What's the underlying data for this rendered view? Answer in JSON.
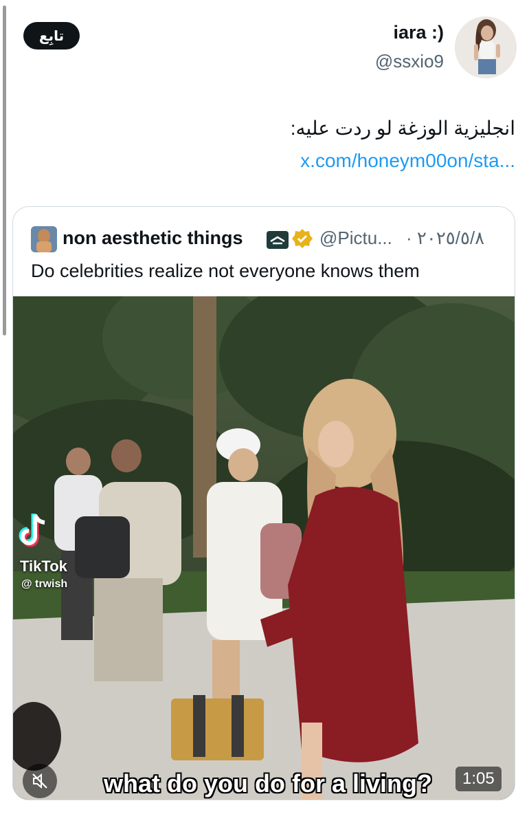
{
  "header": {
    "follow_label": "تابِع",
    "display_name": "iara :)",
    "handle": "@ssxio9"
  },
  "tweet": {
    "text": "انجليزية الوزغة لو ردت عليه:",
    "link": "x.com/honeym00on/sta..."
  },
  "quote": {
    "name": "non aesthetic things",
    "handle": "@Pictu...",
    "date": "٢٠٢٥/٥/٨ ·",
    "text": "Do celebrities realize not everyone knows them",
    "video": {
      "watermark_brand": "TikTok",
      "watermark_user": "@ trwish",
      "subtitle": "what do you do for a living?",
      "duration": "1:05"
    }
  },
  "icons": {
    "verified": "verified-badge-icon",
    "affiliate": "affiliate-label-icon",
    "mute": "speaker-muted-icon",
    "tiktok": "tiktok-logo-icon"
  },
  "colors": {
    "link": "#1d9bf0",
    "verified": "#e8b21a",
    "muted_text": "#536471"
  }
}
